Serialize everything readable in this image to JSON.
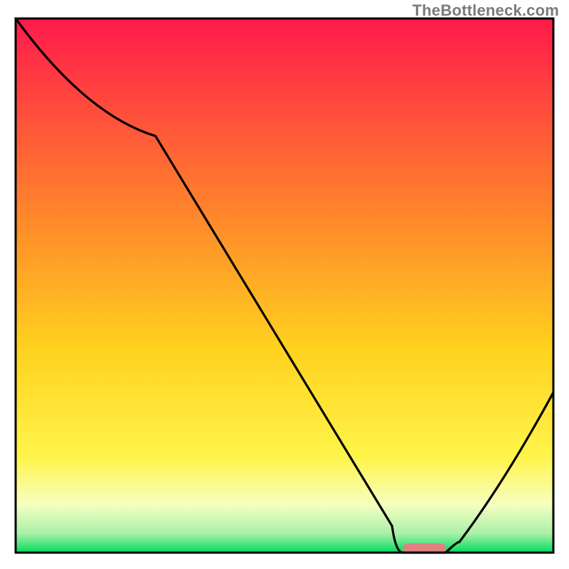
{
  "attribution": "TheBottleneck.com",
  "chart_data": {
    "type": "line",
    "title": "",
    "subtitle": "",
    "xlabel": "",
    "ylabel": "",
    "xlim": [
      0,
      100
    ],
    "ylim": [
      0,
      100
    ],
    "grid": false,
    "legend": false,
    "series": [
      {
        "name": "bottleneck-curve",
        "x": [
          0,
          26,
          70,
          72,
          80,
          82,
          100
        ],
        "y": [
          100,
          78,
          5,
          0,
          0,
          2,
          30
        ]
      }
    ],
    "marker": {
      "name": "optimal-range",
      "type": "bar-segment",
      "x_start": 72,
      "x_end": 80,
      "y": 0,
      "color": "#e08080"
    },
    "background": {
      "type": "vertical-gradient",
      "stops": [
        {
          "pos": 0.0,
          "color": "#ff1a4b"
        },
        {
          "pos": 0.38,
          "color": "#ff8a2a"
        },
        {
          "pos": 0.62,
          "color": "#ffd21f"
        },
        {
          "pos": 0.82,
          "color": "#fff44a"
        },
        {
          "pos": 0.91,
          "color": "#f6ffc0"
        },
        {
          "pos": 0.965,
          "color": "#a8f0a8"
        },
        {
          "pos": 1.0,
          "color": "#00db5b"
        }
      ]
    },
    "frame_color": "#000000",
    "curve_color": "#000000"
  }
}
